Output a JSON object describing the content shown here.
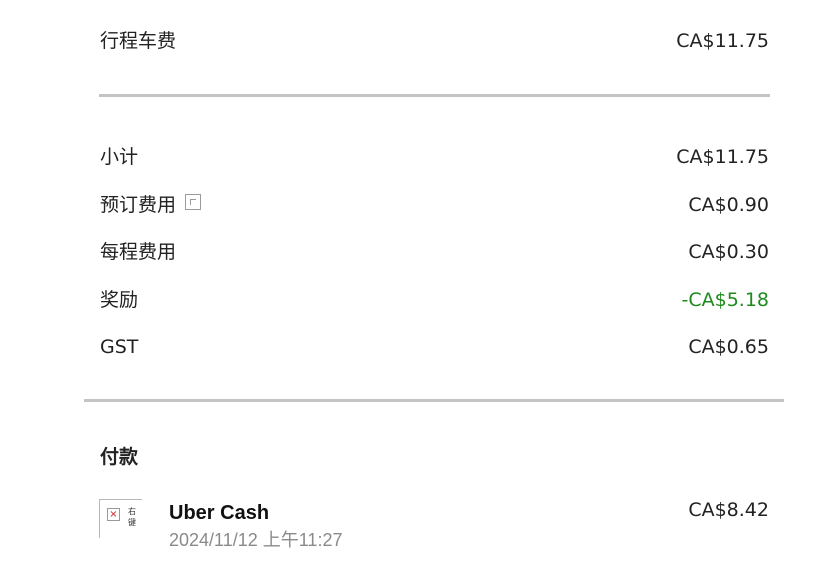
{
  "fare": {
    "label": "行程车费",
    "amount": "CA$11.75"
  },
  "breakdown": [
    {
      "label": "小计",
      "amount": "CA$11.75"
    },
    {
      "label": "预订费用",
      "amount": "CA$0.90"
    },
    {
      "label": "每程费用",
      "amount": "CA$0.30"
    },
    {
      "label": "奖励",
      "amount": "-CA$5.18"
    },
    {
      "label": "GST",
      "amount": "CA$0.65"
    }
  ],
  "payment": {
    "heading": "付款",
    "logo_alt": "右键",
    "method": "Uber Cash",
    "datetime": "2024/11/12 上午11:27",
    "amount": "CA$8.42"
  },
  "colors": {
    "discount": "#1e8a1e",
    "divider": "#c4c4c4",
    "muted_text": "#8a8a8a"
  },
  "icons": {
    "booking_fee_info": "info-icon",
    "payment_logo": "broken-image-icon"
  }
}
